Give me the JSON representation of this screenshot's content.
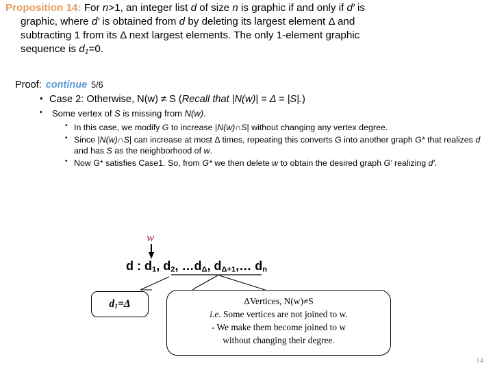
{
  "slide": {
    "page_number": "14",
    "accent_proposition": "#E3A063",
    "accent_continue": "#5B9BD5",
    "accent_w": "#9E2B35"
  },
  "proposition": {
    "label": "Proposition 14:",
    "line1_a": "For ",
    "line1_n": "n",
    "line1_b": ">1, an integer list ",
    "line1_d": "d",
    "line1_c": " of size ",
    "line1_n2": "n",
    "line1_e": " is graphic if and only if ",
    "line1_dp": "d′",
    "line1_f": " is",
    "line2_a": "graphic, where ",
    "line2_dp": "d′",
    "line2_b": " is obtained from ",
    "line2_d": "d",
    "line2_c": " by deleting its largest element Δ and",
    "line3": "subtracting 1 from its Δ next largest elements. The only 1-element graphic",
    "line4_a": "sequence is ",
    "line4_d": "d",
    "line4_sub": "1",
    "line4_b": "=0."
  },
  "proof": {
    "label": "Proof:",
    "continue": "continue",
    "progress": "5/6",
    "bullet_case2_a": "Case 2: Otherwise, N(w) ≠ S (",
    "bullet_case2_italic": "Recall that |N(w)| = Δ = |S|.",
    "bullet_case2_b": ")",
    "bullet_missing_a": "Some vertex of ",
    "bullet_missing_S": "S",
    "bullet_missing_b": " is missing from ",
    "bullet_missing_N": "N(w)",
    "bullet_missing_c": ".",
    "sub_bullets": [
      {
        "a": "In this case, we modify ",
        "i1": "G",
        "b": " to increase |",
        "i2": "N(w)∩S",
        "c": "| without changing any vertex degree."
      },
      {
        "a": "Since |",
        "i1": "N(w)∩S",
        "b": "| can increase at most Δ times, repeating this converts ",
        "i2": "G",
        "c": " into another graph ",
        "i3": "G*",
        "d": " that realizes ",
        "i4": "d",
        "e": " and has ",
        "i5": "S",
        "f": " as the neighborhood of ",
        "i6": "w",
        "g": "."
      },
      {
        "a": "Now G* satisfies Case1. So, from ",
        "i1": "G*",
        "b": " we then delete ",
        "i2": "w",
        "c": " to obtain the desired graph ",
        "i3": "G′",
        "d": " realizing ",
        "i4": "d′",
        "e": "."
      }
    ]
  },
  "diagram": {
    "w_label": "w",
    "sequence": {
      "prefix": "d : d",
      "s1": "1",
      "t1": ", d",
      "s2": "2",
      "t2": ", …d",
      "s3": "Δ",
      "t3": ", d",
      "s4": "Δ+1",
      "t4": ",…  d",
      "s5": "n"
    },
    "box_left": {
      "text_a": "d",
      "sub": "1",
      "text_b": "=Δ"
    },
    "box_right": {
      "line1": "ΔVertices,  N(w)≠S",
      "line2_italic": "i.e.",
      "line2_rest": " Some vertices are not joined to w.",
      "line3": "- We make them become joined  to w",
      "line4": "without changing their degree."
    }
  }
}
